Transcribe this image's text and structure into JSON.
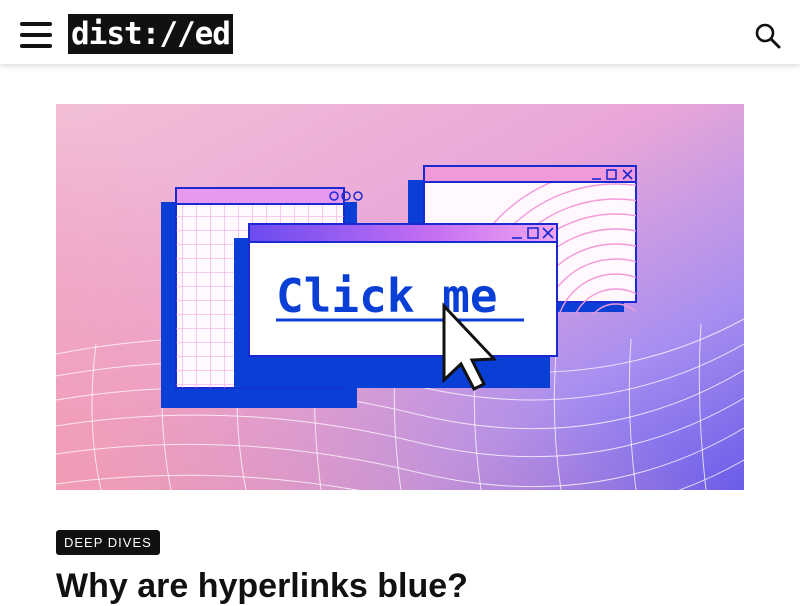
{
  "header": {
    "logo_text": "dist://ed",
    "menu_icon": "hamburger-menu-icon",
    "search_icon": "search-icon"
  },
  "hero": {
    "button_text": "Click me",
    "cursor_icon": "arrow-cursor-icon",
    "colors": {
      "blue": "#0a3fd6",
      "pink": "#f29ad9",
      "purple": "#c06af0",
      "bg_pink": "#f2a2c0",
      "bg_violet": "#7f6ce8"
    }
  },
  "article": {
    "category": "DEEP DIVES",
    "title": "Why are hyperlinks blue?"
  }
}
